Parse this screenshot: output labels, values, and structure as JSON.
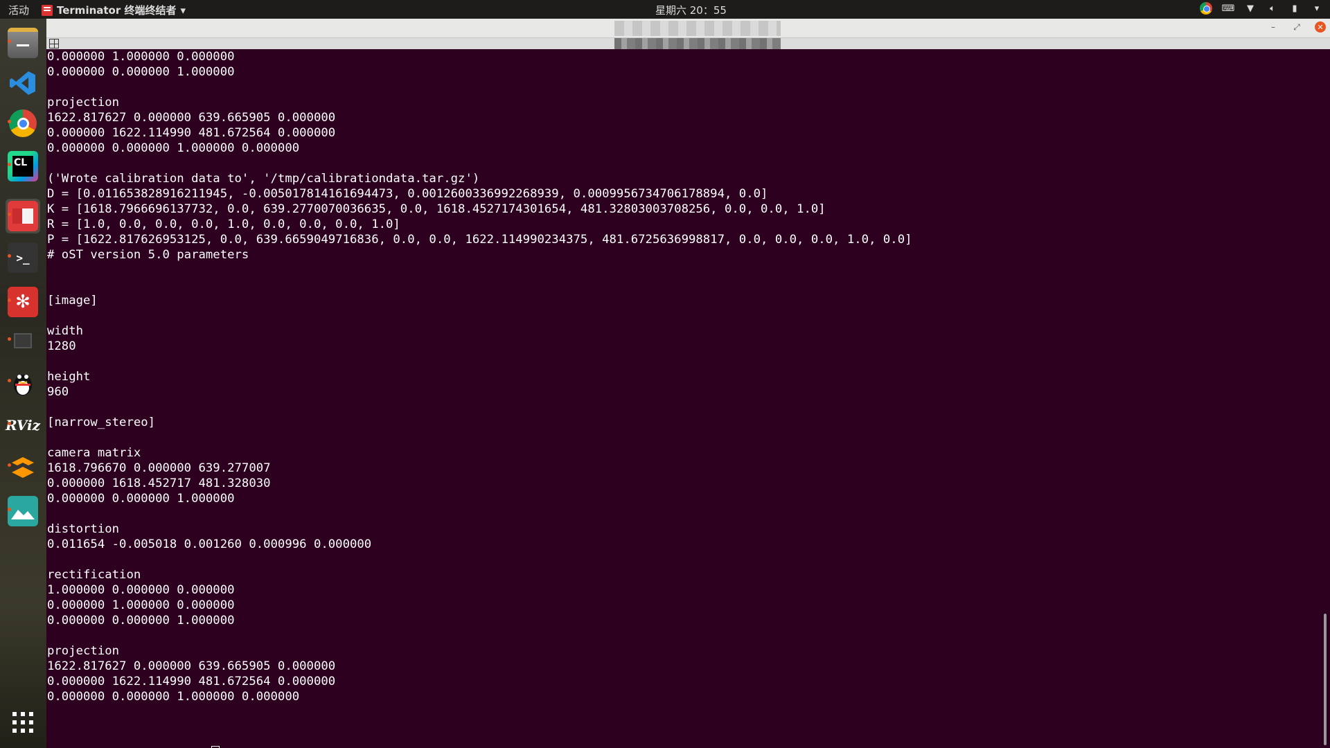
{
  "topbar": {
    "activities": "活动",
    "app_name": "Terminator 终端终结者",
    "app_menu_arrow": "▾",
    "clock": "星期六 20：55",
    "tray": [
      "chrome-icon",
      "keyboard-icon",
      "wifi-icon",
      "volume-icon",
      "battery-icon",
      "system-menu-icon"
    ]
  },
  "dock": {
    "items": [
      "files-icon",
      "vscode-icon",
      "chrome-icon",
      "clion-icon",
      "document-viewer-icon",
      "terminal-icon",
      "xmind-icon",
      "generic-window-icon",
      "qq-icon",
      "rviz-icon",
      "sublime-icon",
      "image-viewer-icon",
      "app-grid-icon"
    ],
    "rviz_label": "RViz",
    "clion_label": "CL"
  },
  "window": {
    "controls": {
      "minimize": "–",
      "maximize": "⤢",
      "close": "✕"
    }
  },
  "terminal": {
    "lines": [
      "0.000000 1.000000 0.000000",
      "0.000000 0.000000 1.000000",
      "",
      "projection",
      "1622.817627 0.000000 639.665905 0.000000",
      "0.000000 1622.114990 481.672564 0.000000",
      "0.000000 0.000000 1.000000 0.000000",
      "",
      "('Wrote calibration data to', '/tmp/calibrationdata.tar.gz')",
      "D = [0.011653828916211945, -0.005017814161694473, 0.0012600336992268939, 0.0009956734706178894, 0.0]",
      "K = [1618.7966696137732, 0.0, 639.2770070036635, 0.0, 1618.4527174301654, 481.32803003708256, 0.0, 0.0, 1.0]",
      "R = [1.0, 0.0, 0.0, 0.0, 1.0, 0.0, 0.0, 0.0, 1.0]",
      "P = [1622.817626953125, 0.0, 639.6659049716836, 0.0, 0.0, 1622.114990234375, 481.6725636998817, 0.0, 0.0, 0.0, 1.0, 0.0]",
      "# oST version 5.0 parameters",
      "",
      "",
      "[image]",
      "",
      "width",
      "1280",
      "",
      "height",
      "960",
      "",
      "[narrow_stereo]",
      "",
      "camera matrix",
      "1618.796670 0.000000 639.277007",
      "0.000000 1618.452717 481.328030",
      "0.000000 0.000000 1.000000",
      "",
      "distortion",
      "0.011654 -0.005018 0.001260 0.000996 0.000000",
      "",
      "rectification",
      "1.000000 0.000000 0.000000",
      "0.000000 1.000000 0.000000",
      "0.000000 0.000000 1.000000",
      "",
      "projection",
      "1622.817627 0.000000 639.665905 0.000000",
      "0.000000 1622.114990 481.672564 0.000000",
      "0.000000 0.000000 1.000000 0.000000"
    ],
    "prompt_suffix": "~$ "
  }
}
